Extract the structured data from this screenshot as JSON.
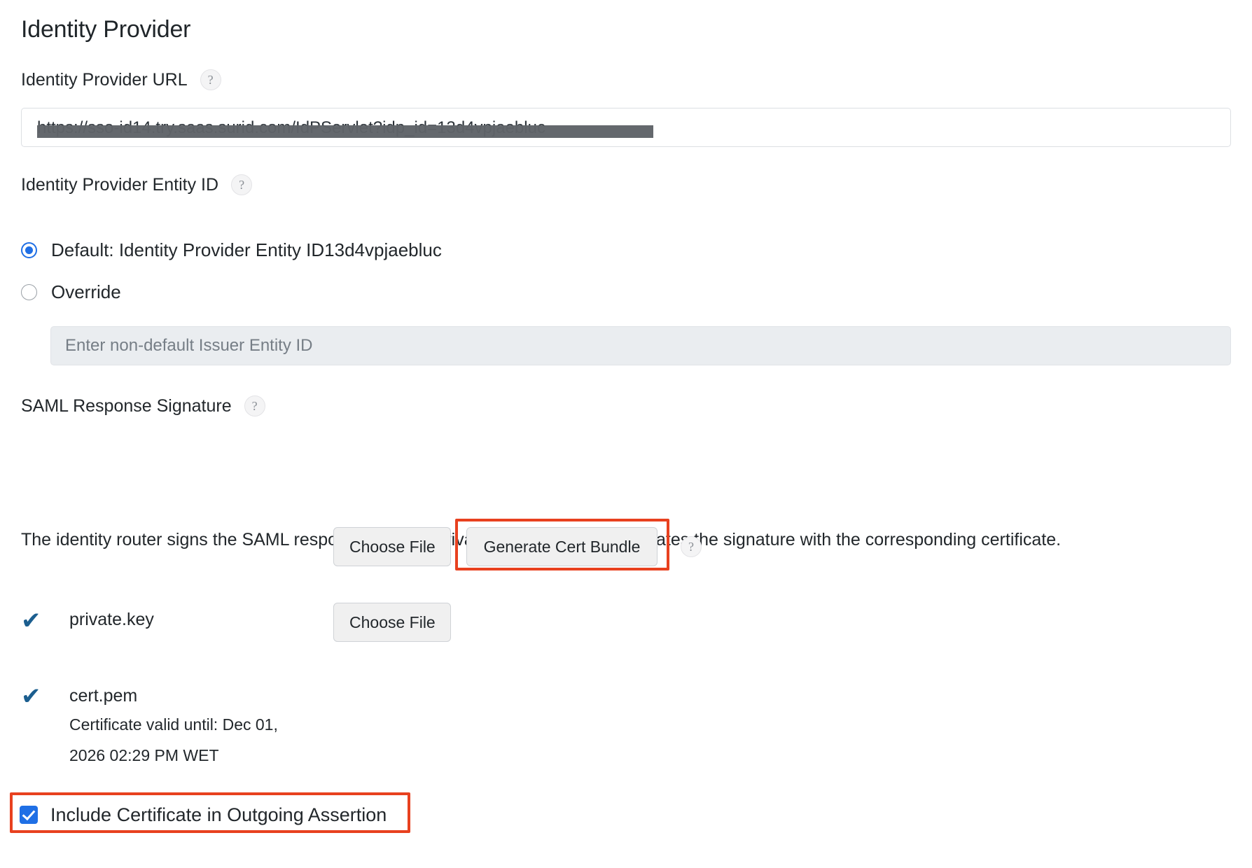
{
  "page": {
    "title": "Identity Provider"
  },
  "idp_url": {
    "label": "Identity Provider URL",
    "help_icon": "?",
    "value": "https://sso-id14.try.saas.surid.com/IdPServlet?idp_id=13d4vpjaebluc",
    "redacted": true
  },
  "idp_entity_id": {
    "label": "Identity Provider Entity ID",
    "help_icon": "?",
    "options": [
      {
        "label": "Default: Identity Provider Entity ID13d4vpjaebluc",
        "selected": true
      },
      {
        "label": "Override",
        "selected": false
      }
    ],
    "override_input_placeholder": "Enter non-default Issuer Entity ID",
    "override_input_value": ""
  },
  "saml_signature": {
    "label": "SAML Response Signature",
    "help_icon": "?",
    "description": "The identity router signs the SAML response with the private key, and the SP validates the signature with the corresponding certificate.",
    "files": [
      {
        "status_icon": "check-icon",
        "name": "private.key",
        "meta": "",
        "choose_file_label": "Choose File",
        "generate_label": "Generate Cert Bundle",
        "generate_help_icon": "?"
      },
      {
        "status_icon": "check-icon",
        "name": "cert.pem",
        "meta": "Certificate valid until: Dec 01, 2026 02:29 PM WET",
        "choose_file_label": "Choose File"
      }
    ]
  },
  "include_certificate": {
    "label": "Include Certificate in Outgoing Assertion",
    "checked": true
  },
  "colors": {
    "accent_blue": "#1f6fe5",
    "annotation_red": "#e8411f",
    "check_teal": "#1b5e8f",
    "text": "#22272b"
  }
}
